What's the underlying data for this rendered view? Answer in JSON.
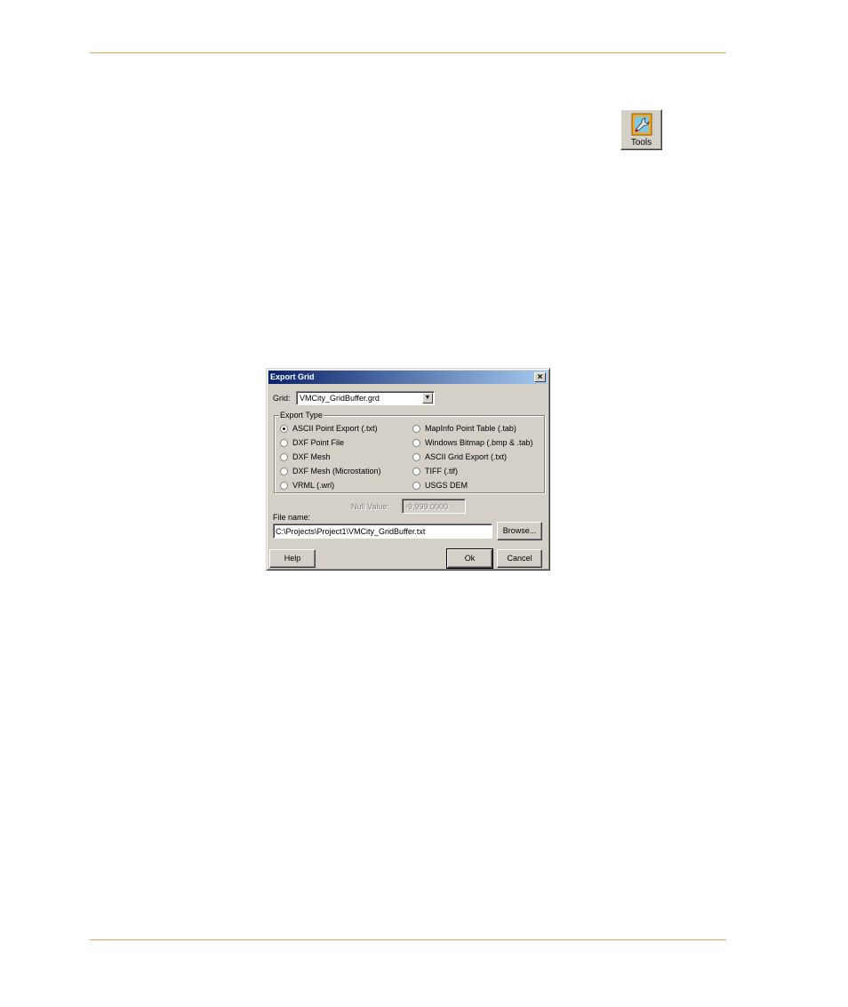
{
  "toolbar": {
    "tools_label": "Tools"
  },
  "dialog": {
    "title": "Export Grid",
    "close_symbol": "×",
    "grid_label": "Grid:",
    "grid_value": "VMCity_GridBuffer.grd",
    "export_type_label": "Export Type",
    "options_left": [
      {
        "label": "ASCII Point Export (.txt)",
        "selected": true
      },
      {
        "label": "DXF Point File",
        "selected": false
      },
      {
        "label": "DXF Mesh",
        "selected": false
      },
      {
        "label": "DXF Mesh (Microstation)",
        "selected": false
      },
      {
        "label": "VRML (.wrl)",
        "selected": false
      }
    ],
    "options_right": [
      {
        "label": "MapInfo Point Table (.tab)",
        "selected": false
      },
      {
        "label": "Windows Bitmap (.bmp & .tab)",
        "selected": false
      },
      {
        "label": "ASCII Grid Export (.txt)",
        "selected": false
      },
      {
        "label": "TIFF (.tif)",
        "selected": false
      },
      {
        "label": "USGS DEM",
        "selected": false
      }
    ],
    "null_value_label": "Null Value:",
    "null_value": "-9,999.0000",
    "file_name_label": "File name:",
    "file_name_value": "C:\\Projects\\Project1\\VMCity_GridBuffer.txt",
    "browse_label": "Browse...",
    "help_label": "Help",
    "ok_label": "Ok",
    "cancel_label": "Cancel"
  },
  "colors": {
    "rule": "#e3a257",
    "titlebar_start": "#0a246a",
    "titlebar_end": "#a6caf0",
    "dialog_face": "#d4d0c8"
  }
}
